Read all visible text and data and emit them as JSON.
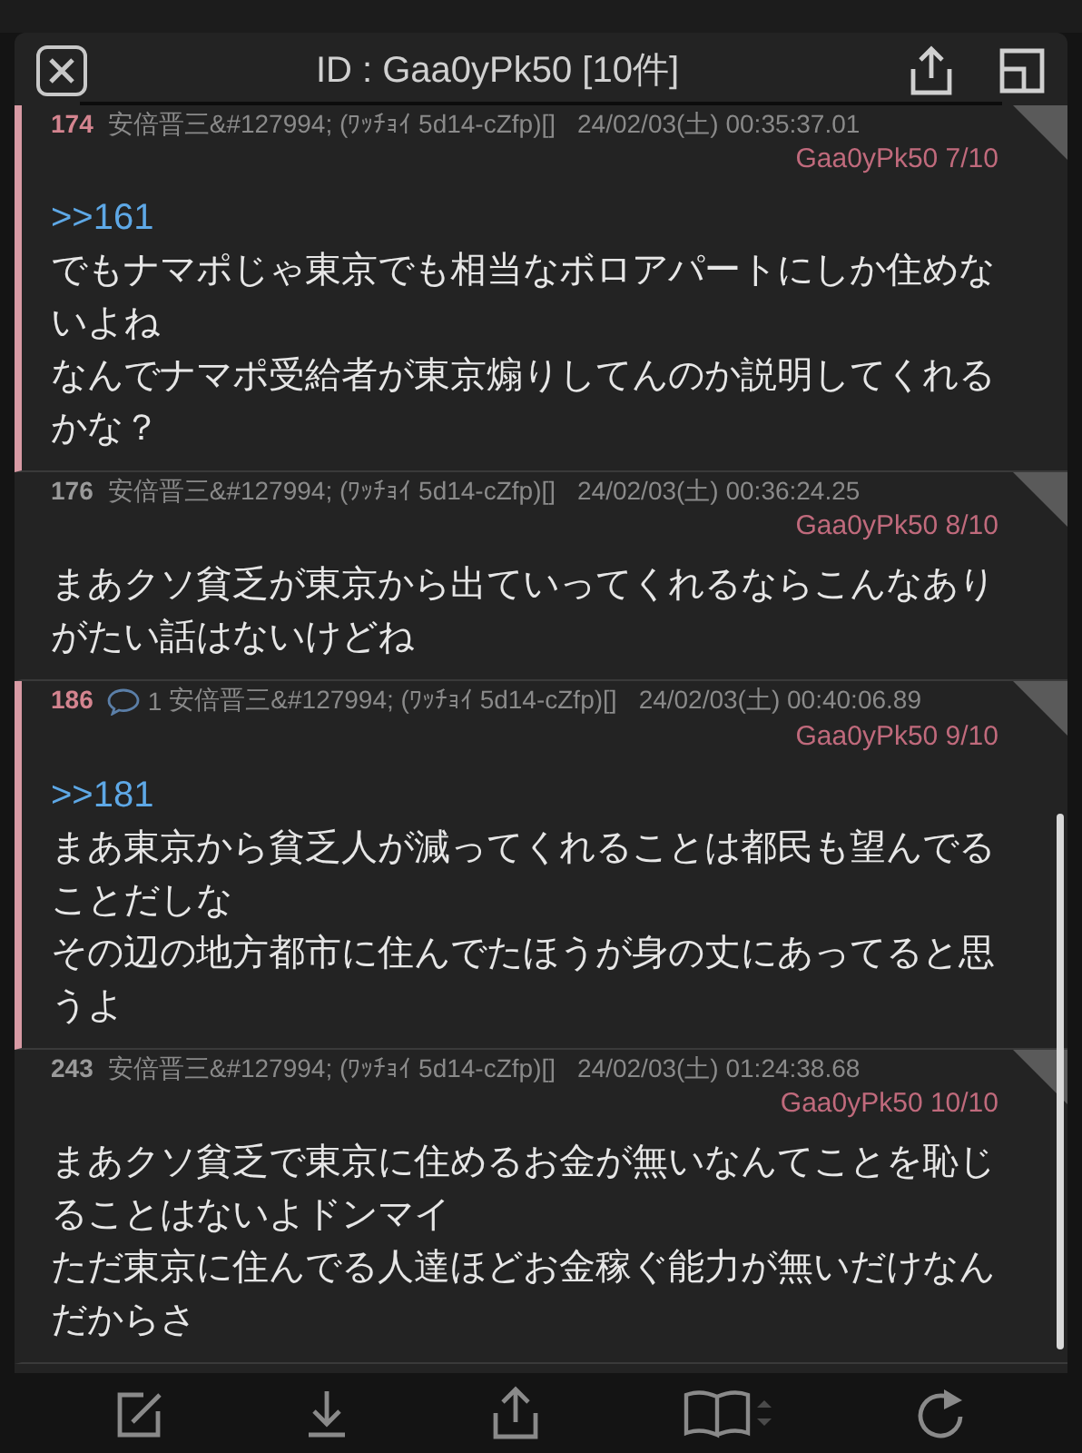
{
  "popup": {
    "title": "ID : Gaa0yPk50 [10件]"
  },
  "posts": [
    {
      "number": "174",
      "marked": true,
      "name": "安倍晋三&#127994; (ﾜｯﾁｮｲ 5d14-cZfp)[]",
      "date": "24/02/03(土) 00:35:37.01",
      "id": "Gaa0yPk50 7/10",
      "anchor": ">>161",
      "paragraphs": [
        "でもナマポじゃ東京でも相当なボロアパートにしか住めないよね",
        "なんでナマポ受給者が東京煽りしてんのか説明してくれるかな？"
      ]
    },
    {
      "number": "176",
      "marked": false,
      "name": "安倍晋三&#127994; (ﾜｯﾁｮｲ 5d14-cZfp)[]",
      "date": "24/02/03(土) 00:36:24.25",
      "id": "Gaa0yPk50 8/10",
      "paragraphs": [
        "まあクソ貧乏が東京から出ていってくれるならこんなありがたい話はないけどね"
      ]
    },
    {
      "number": "186",
      "marked": true,
      "replies": "1",
      "name": "安倍晋三&#127994; (ﾜｯﾁｮｲ 5d14-cZfp)[]",
      "date": "24/02/03(土) 00:40:06.89",
      "id": "Gaa0yPk50 9/10",
      "anchor": ">>181",
      "paragraphs": [
        "まあ東京から貧乏人が減ってくれることは都民も望んでることだしな",
        "その辺の地方都市に住んでたほうが身の丈にあってると思うよ"
      ]
    },
    {
      "number": "243",
      "marked": false,
      "name": "安倍晋三&#127994; (ﾜｯﾁｮｲ 5d14-cZfp)[]",
      "date": "24/02/03(土) 01:24:38.68",
      "id": "Gaa0yPk50 10/10",
      "paragraphs": [
        "まあクソ貧乏で東京に住めるお金が無いなんてことを恥じることはないよドンマイ",
        "ただ東京に住んでる人達ほどお金稼ぐ能力が無いだけなんだからさ"
      ]
    }
  ]
}
